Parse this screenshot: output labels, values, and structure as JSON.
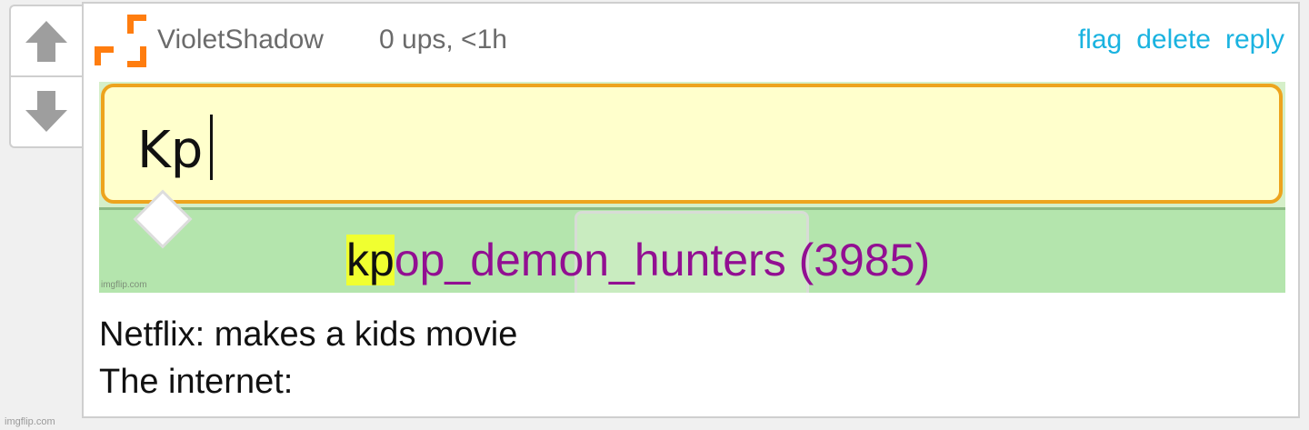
{
  "vote": {
    "up_icon": "arrow-up-icon",
    "down_icon": "arrow-down-icon",
    "icon_color": "#9e9e9e"
  },
  "comment": {
    "avatar_icon": "imgflip-user-avatar-icon",
    "avatar_color": "#ff7d0f",
    "username": "VioletShadow",
    "meta": "0 ups, <1h",
    "actions": {
      "flag": "flag",
      "delete": "delete",
      "reply": "reply"
    },
    "link_color": "#1ab3e0",
    "meme": {
      "search_query": "Kp",
      "suggestion_match": "kp",
      "suggestion_rest": "op_demon_hunters (3985)",
      "watermark": "imgflip.com",
      "input_bg": "#ffffcc",
      "input_border": "#eda41e",
      "band_color": "#b4e5ad",
      "highlight_color": "#f0ff30",
      "suggestion_color": "#920f92"
    },
    "text_lines": [
      "Netflix: makes a kids movie",
      "The internet:"
    ]
  },
  "footer": {
    "watermark": "imgflip.com"
  }
}
